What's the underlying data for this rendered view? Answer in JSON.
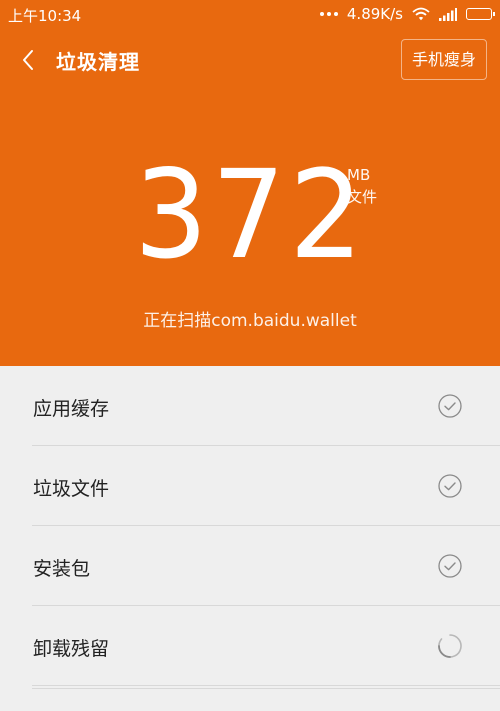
{
  "status_bar": {
    "time": "上午10:34",
    "network_speed": "4.89K/s",
    "icons": [
      "more-dots-icon",
      "wifi-icon",
      "signal-icon",
      "battery-icon"
    ]
  },
  "toolbar": {
    "back_icon": "chevron-left-icon",
    "title": "垃圾清理",
    "slim_button_label": "手机瘦身"
  },
  "scan": {
    "size_value": "372",
    "size_unit": "MB",
    "size_subunit": "文件",
    "status_text": "正在扫描com.baidu.wallet"
  },
  "categories": [
    {
      "label": "应用缓存",
      "state": "checked"
    },
    {
      "label": "垃圾文件",
      "state": "checked"
    },
    {
      "label": "安装包",
      "state": "checked"
    },
    {
      "label": "卸载残留",
      "state": "loading"
    }
  ],
  "colors": {
    "accent": "#e8690f",
    "list_background": "#efefef",
    "divider": "#d8d8d8",
    "check_circle": "#8a8a8a"
  }
}
